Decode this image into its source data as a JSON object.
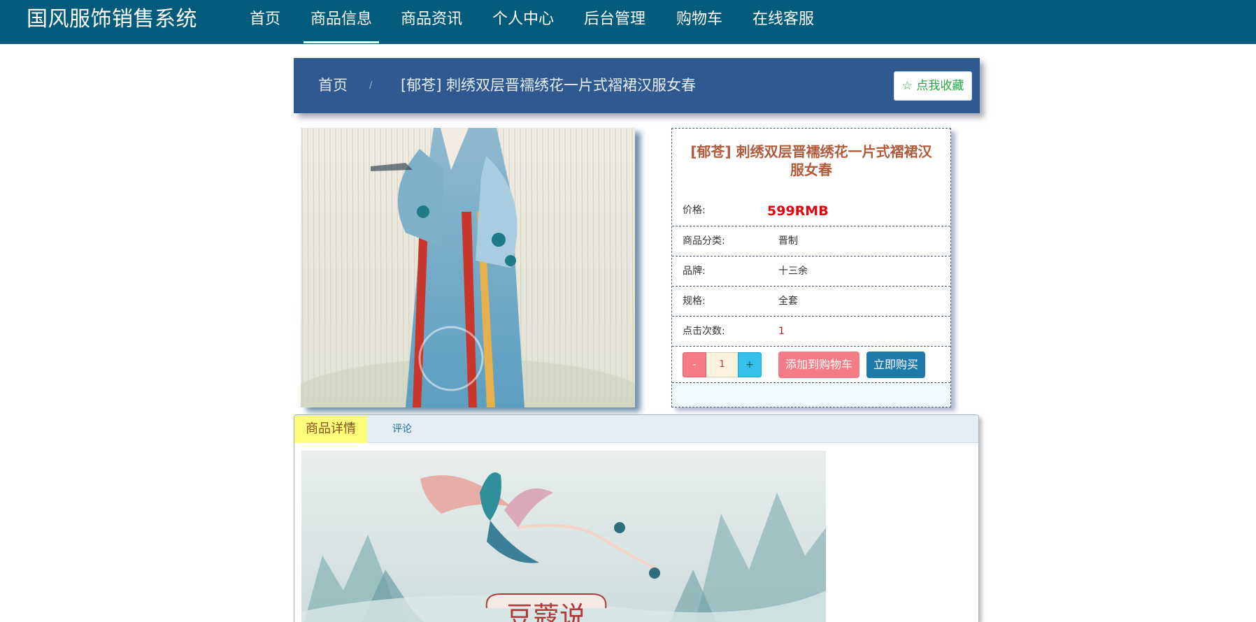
{
  "app": {
    "title": "国风服饰销售系统"
  },
  "nav": {
    "items": [
      {
        "label": "首页"
      },
      {
        "label": "商品信息",
        "active": true
      },
      {
        "label": "商品资讯"
      },
      {
        "label": "个人中心"
      },
      {
        "label": "后台管理"
      },
      {
        "label": "购物车"
      },
      {
        "label": "在线客服"
      }
    ]
  },
  "breadcrumb": {
    "home": "首页",
    "separator": "/",
    "current": "[郁苍] 刺绣双层晋襦绣花一片式褶裙汉服女春"
  },
  "favorite_button": {
    "icon": "star-outline-icon",
    "label": "☆ 点我收藏"
  },
  "product": {
    "title": "[郁苍] 刺绣双层晋襦绣花一片式褶裙汉服女春",
    "price_label": "价格:",
    "price": "599RMB",
    "fields": [
      {
        "label": "商品分类:",
        "value": "晋制"
      },
      {
        "label": "品牌:",
        "value": "十三余"
      },
      {
        "label": "规格:",
        "value": "全套"
      },
      {
        "label": "点击次数:",
        "value": "1"
      }
    ],
    "quantity": {
      "minus": "-",
      "value": "1",
      "plus": "+"
    },
    "add_to_cart": "添加到购物车",
    "buy_now": "立即购买"
  },
  "tabs": [
    {
      "label": "商品详情",
      "active": true
    },
    {
      "label": "评论"
    }
  ],
  "detail_banner": {
    "text": "豆蔻说"
  },
  "colors": {
    "nav_bg": "#035b7b",
    "breadcrumb_bg": "#2e5a8f",
    "price": "#e8000b",
    "title": "#b05a3a",
    "pink_button": "#f47c87",
    "blue_button": "#1e7ba9",
    "tab_active": "#fdff7a"
  }
}
